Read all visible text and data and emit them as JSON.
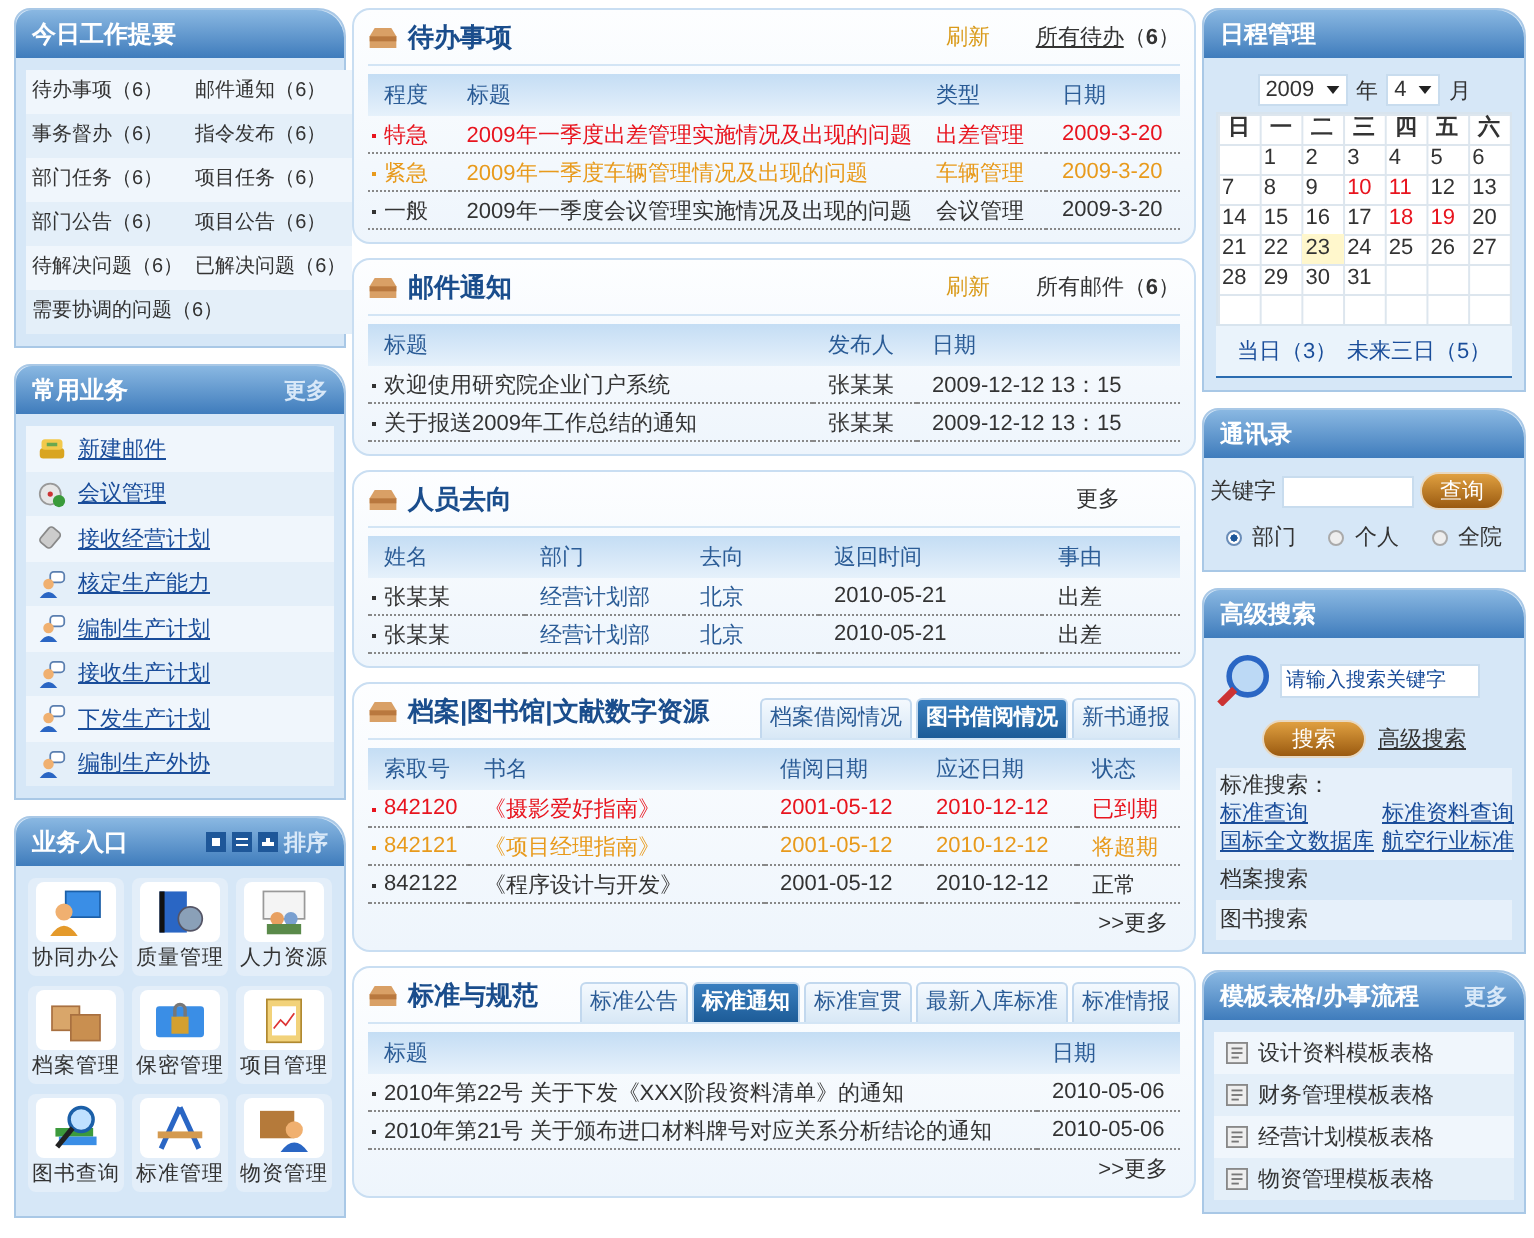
{
  "work_summary": {
    "title": "今日工作提要",
    "items": [
      "待办事项（6）",
      "邮件通知（6）",
      "事务督办（6）",
      "指令发布（6）",
      "部门任务（6）",
      "项目任务（6）",
      "部门公告（6）",
      "项目公告（6）",
      "待解决问题（6）",
      "已解决问题（6）",
      "需要协调的问题（6）"
    ]
  },
  "common_business": {
    "title": "常用业务",
    "more": "更多",
    "items": [
      "新建邮件",
      "会议管理",
      "接收经营计划",
      "核定生产能力",
      "编制生产计划",
      "接收生产计划",
      "下发生产计划",
      "编制生产外协"
    ]
  },
  "business_entry": {
    "title": "业务入口",
    "sort": "排序",
    "items": [
      "协同办公",
      "质量管理",
      "人力资源",
      "档案管理",
      "保密管理",
      "项目管理",
      "图书查询",
      "标准管理",
      "物资管理"
    ]
  },
  "todo": {
    "title": "待办事项",
    "refresh": "刷新",
    "all_link": "所有待办",
    "count": "（**6**）",
    "columns": [
      "程度",
      "标题",
      "类型",
      "日期"
    ],
    "rows": [
      {
        "priority": "特急",
        "title": "2009年一季度出差管理实施情况及出现的问题",
        "type": "出差管理",
        "date": "2009-3-20",
        "color": "#e8141e"
      },
      {
        "priority": "紧急",
        "title": "2009年一季度车辆管理情况及出现的问题",
        "type": "车辆管理",
        "date": "2009-3-20",
        "color": "#e89a1c"
      },
      {
        "priority": "一般",
        "title": "2009年一季度会议管理实施情况及出现的问题",
        "type": "会议管理",
        "date": "2009-3-20",
        "color": "#333333"
      }
    ]
  },
  "mail": {
    "title": "邮件通知",
    "refresh": "刷新",
    "all_link": "所有邮件",
    "count": "（**6**）",
    "columns": [
      "标题",
      "发布人",
      "日期"
    ],
    "rows": [
      {
        "title": "欢迎使用研究院企业门户系统",
        "sender": "张某某",
        "date": "2009-12-12 13：15"
      },
      {
        "title": "关于报送2009年工作总结的通知",
        "sender": "张某某",
        "date": "2009-12-12 13：15"
      }
    ]
  },
  "staff": {
    "title": "人员去向",
    "more": "更多",
    "columns": [
      "姓名",
      "部门",
      "去向",
      "返回时间",
      "事由"
    ],
    "rows": [
      {
        "name": "张某某",
        "dept": "经营计划部",
        "destination": "北京",
        "return_date": "2010-05-21",
        "reason": "出差"
      },
      {
        "name": "张某某",
        "dept": "经营计划部",
        "destination": "北京",
        "return_date": "2010-05-21",
        "reason": "出差"
      }
    ]
  },
  "archive": {
    "title": "档案|图书馆|文献数字资源",
    "tabs": [
      {
        "label": "档案借阅情况",
        "selected": false
      },
      {
        "label": "图书借阅情况",
        "selected": true
      },
      {
        "label": "新书通报",
        "selected": false
      }
    ],
    "columns": [
      "索取号",
      "书名",
      "借阅日期",
      "应还日期",
      "状态"
    ],
    "rows": [
      {
        "call_no": "842120",
        "book": "《摄影爱好指南》",
        "borrow_date": "2001-05-12",
        "due_date": "2010-12-12",
        "status": "已到期",
        "color": "#e8141e"
      },
      {
        "call_no": "842121",
        "book": "《项目经理指南》",
        "borrow_date": "2001-05-12",
        "due_date": "2010-12-12",
        "status": "将超期",
        "color": "#e89a1c"
      },
      {
        "call_no": "842122",
        "book": "《程序设计与开发》",
        "borrow_date": "2001-05-12",
        "due_date": "2010-12-12",
        "status": "正常",
        "color": "#333333"
      }
    ],
    "more": ">>更多"
  },
  "standards": {
    "title": "标准与规范",
    "tabs": [
      {
        "label": "标准公告",
        "selected": false
      },
      {
        "label": "标准通知",
        "selected": true
      },
      {
        "label": "标准宣贯",
        "selected": false
      },
      {
        "label": "最新入库标准",
        "selected": false
      },
      {
        "label": "标准情报",
        "selected": false
      }
    ],
    "columns": [
      "标题",
      "日期"
    ],
    "rows": [
      {
        "title": "2010年第22号 关于下发《XXX阶段资料清单》的通知",
        "date": "2010-05-06"
      },
      {
        "title": "2010年第21号 关于颁布进口材料牌号对应关系分析结论的通知",
        "date": "2010-05-06"
      }
    ],
    "more": ">>更多"
  },
  "schedule": {
    "title": "日程管理",
    "year": "2009",
    "year_unit": "年",
    "month": "4",
    "month_unit": "月",
    "weekdays": [
      "日",
      "一",
      "二",
      "三",
      "四",
      "五",
      "六"
    ],
    "weeks": [
      {
        "kind": "lead",
        "days": [
          {
            "day": "1",
            "event": false,
            "today": false
          },
          {
            "day": "2",
            "event": false,
            "today": false
          },
          {
            "day": "3",
            "event": false,
            "today": false
          },
          {
            "day": "4",
            "event": false,
            "today": false
          },
          {
            "day": "5",
            "event": false,
            "today": false
          },
          {
            "day": "6",
            "event": false,
            "today": false
          }
        ]
      },
      {
        "kind": "full",
        "days": [
          {
            "day": "7",
            "event": false,
            "today": false
          },
          {
            "day": "8",
            "event": false,
            "today": false
          },
          {
            "day": "9",
            "event": false,
            "today": false
          },
          {
            "day": "10",
            "event": true,
            "today": false
          },
          {
            "day": "11",
            "event": true,
            "today": false
          },
          {
            "day": "12",
            "event": false,
            "today": false
          },
          {
            "day": "13",
            "event": false,
            "today": false
          }
        ]
      },
      {
        "kind": "full",
        "days": [
          {
            "day": "14",
            "event": false,
            "today": false
          },
          {
            "day": "15",
            "event": false,
            "today": false
          },
          {
            "day": "16",
            "event": false,
            "today": false
          },
          {
            "day": "17",
            "event": false,
            "today": false
          },
          {
            "day": "18",
            "event": true,
            "today": false
          },
          {
            "day": "19",
            "event": true,
            "today": false
          },
          {
            "day": "20",
            "event": false,
            "today": false
          }
        ]
      },
      {
        "kind": "full",
        "days": [
          {
            "day": "21",
            "event": false,
            "today": false
          },
          {
            "day": "22",
            "event": false,
            "today": false
          },
          {
            "day": "23",
            "event": false,
            "today": true
          },
          {
            "day": "24",
            "event": false,
            "today": false
          },
          {
            "day": "25",
            "event": false,
            "today": false
          },
          {
            "day": "26",
            "event": false,
            "today": false
          },
          {
            "day": "27",
            "event": false,
            "today": false
          }
        ]
      },
      {
        "kind": "trail",
        "days": [
          {
            "day": "28",
            "event": false,
            "today": false
          },
          {
            "day": "29",
            "event": false,
            "today": false
          },
          {
            "day": "30",
            "event": false,
            "today": false
          },
          {
            "day": "31",
            "event": false,
            "today": false
          }
        ]
      }
    ],
    "links": [
      "当日（3）",
      "未来三日（5）"
    ]
  },
  "contacts": {
    "title": "通讯录",
    "keyword_label": "关键字",
    "button": "查询",
    "radios": [
      {
        "label": "部门",
        "selected": true
      },
      {
        "label": "个人",
        "selected": false
      },
      {
        "label": "全院",
        "selected": false
      }
    ]
  },
  "advanced_search": {
    "title": "高级搜索",
    "placeholder": "请输入搜索关键字",
    "button": "搜索",
    "advanced_link": "高级搜索",
    "standard_label": "标准搜索：",
    "standard_links": [
      "标准查询",
      "标准资料查询",
      "国标全文数据库",
      "航空行业标准"
    ],
    "archive_label": "档案搜索",
    "book_label": "图书搜索"
  },
  "templates": {
    "title": "模板表格/办事流程",
    "more": "更多",
    "items": [
      "设计资料模板表格",
      "财务管理模板表格",
      "经营计划模板表格",
      "物资管理模板表格"
    ]
  }
}
